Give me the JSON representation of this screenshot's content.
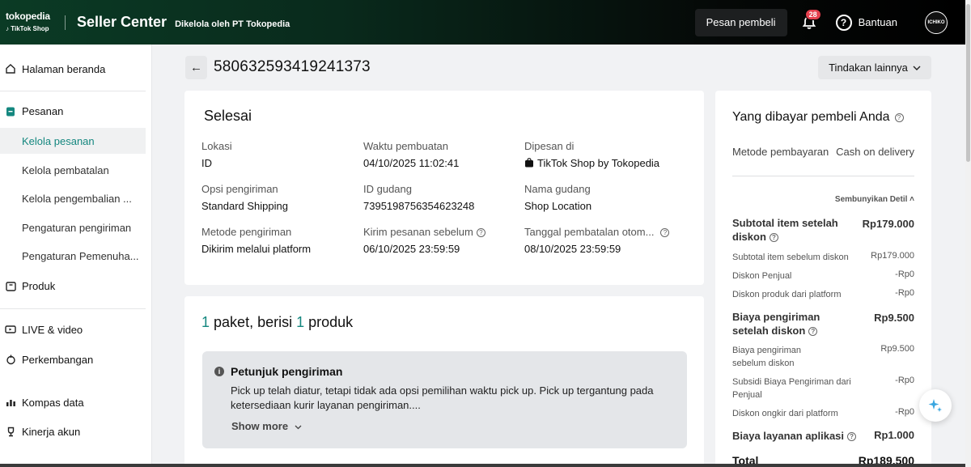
{
  "header": {
    "brand_tokopedia": "tokopedia",
    "brand_tiktok": "TikTok Shop",
    "title": "Seller Center",
    "subtitle": "Dikelola oleh PT Tokopedia",
    "pesan_pembeli": "Pesan pembeli",
    "notif_count": "28",
    "help_label": "Bantuan",
    "avatar_text": "ICHIKO"
  },
  "sidebar": {
    "home": "Halaman beranda",
    "orders": "Pesanan",
    "orders_sub": [
      "Kelola pesanan",
      "Kelola pembatalan",
      "Kelola pengembalian ...",
      "Pengaturan pengiriman",
      "Pengaturan Pemenuha..."
    ],
    "products": "Produk",
    "live": "LIVE & video",
    "growth": "Perkembangan",
    "compass": "Kompas data",
    "performance": "Kinerja akun"
  },
  "order": {
    "id": "580632593419241373",
    "more_actions": "Tindakan lainnya",
    "status": "Selesai",
    "fields": {
      "lokasi_label": "Lokasi",
      "lokasi_value": "ID",
      "waktu_label": "Waktu pembuatan",
      "waktu_value": "04/10/2025 11:02:41",
      "dipesan_label": "Dipesan di",
      "dipesan_value": "TikTok Shop by Tokopedia",
      "opsi_label": "Opsi pengiriman",
      "opsi_value": "Standard Shipping",
      "gudang_label": "ID gudang",
      "gudang_value": "7395198756354623248",
      "nama_gudang_label": "Nama gudang",
      "nama_gudang_value": "Shop Location",
      "metode_label": "Metode pengiriman",
      "metode_value": "Dikirim melalui platform",
      "kirim_label": "Kirim pesanan sebelum",
      "kirim_value": "06/10/2025 23:59:59",
      "batal_label": "Tanggal pembatalan otom...",
      "batal_value": "08/10/2025 23:59:59"
    }
  },
  "package": {
    "count1": "1",
    "text1": "paket, berisi",
    "count2": "1",
    "text2": "produk",
    "hint_title": "Petunjuk pengiriman",
    "hint_text": "Pick up telah diatur, tetapi tidak ada opsi pemilihan waktu pick up. Pick up tergantung pada ketersediaan kurir layanan pengiriman....",
    "show_more": "Show more"
  },
  "payment": {
    "title": "Yang dibayar pembeli Anda",
    "method_label": "Metode pembayaran",
    "method_value": "Cash on delivery",
    "hide_detail": "Sembunyikan Detil",
    "subtotal_label": "Subtotal item setelah diskon",
    "subtotal_value": "Rp179.000",
    "subtotal_before_label": "Subtotal item sebelum diskon",
    "subtotal_before_value": "Rp179.000",
    "seller_disc_label": "Diskon Penjual",
    "seller_disc_value": "-Rp0",
    "platform_disc_label": "Diskon produk dari platform",
    "platform_disc_value": "-Rp0",
    "ship_label": "Biaya pengiriman setelah diskon",
    "ship_value": "Rp9.500",
    "ship_before_label": "Biaya pengiriman sebelum diskon",
    "ship_before_value": "Rp9.500",
    "ship_subsidy_label": "Subsidi Biaya Pengiriman dari Penjual",
    "ship_subsidy_value": "-Rp0",
    "ship_platform_label": "Diskon ongkir dari platform",
    "ship_platform_value": "-Rp0",
    "service_label": "Biaya layanan aplikasi",
    "service_value": "Rp1.000",
    "total_label": "Total",
    "total_value": "Rp189.500"
  }
}
